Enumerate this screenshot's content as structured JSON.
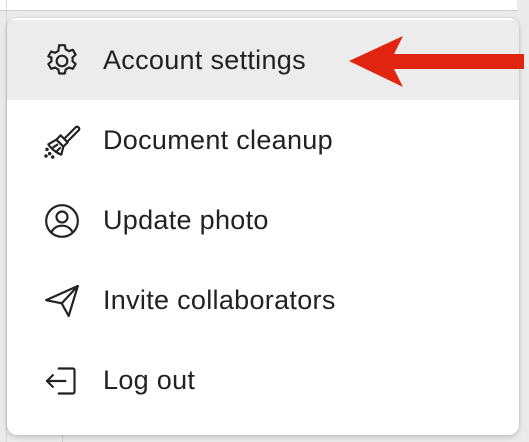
{
  "menu": {
    "items": [
      {
        "label": "Account settings",
        "icon": "gear-icon",
        "active": true
      },
      {
        "label": "Document cleanup",
        "icon": "broom-icon",
        "active": false
      },
      {
        "label": "Update photo",
        "icon": "user-circle-icon",
        "active": false
      },
      {
        "label": "Invite collaborators",
        "icon": "paper-plane-icon",
        "active": false
      },
      {
        "label": "Log out",
        "icon": "logout-icon",
        "active": false
      }
    ]
  },
  "annotation": {
    "arrow_color": "#e0240f",
    "points_to": "Account settings"
  },
  "colors": {
    "active_row": "#ececec",
    "text": "#222222"
  }
}
